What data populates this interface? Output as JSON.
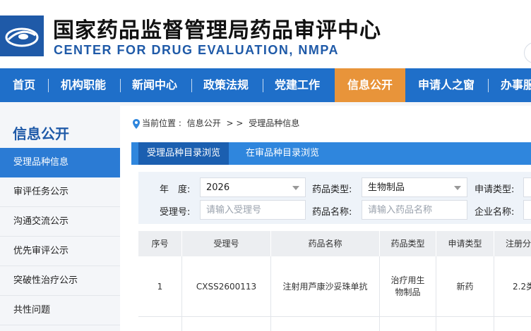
{
  "header": {
    "title": "国家药品监督管理局药品审评中心",
    "subtitle": "CENTER FOR DRUG EVALUATION, NMPA"
  },
  "nav": {
    "items": [
      {
        "label": "首页"
      },
      {
        "label": "机构职能"
      },
      {
        "label": "新闻中心"
      },
      {
        "label": "政策法规"
      },
      {
        "label": "党建工作"
      },
      {
        "label": "信息公开",
        "active": true
      },
      {
        "label": "申请人之窗"
      },
      {
        "label": "办事服"
      }
    ]
  },
  "sidebar": {
    "title": "信息公开",
    "items": [
      {
        "label": "受理品种信息",
        "active": true
      },
      {
        "label": "审评任务公示"
      },
      {
        "label": "沟通交流公示"
      },
      {
        "label": "优先审评公示"
      },
      {
        "label": "突破性治疗公示"
      },
      {
        "label": "共性问题"
      }
    ]
  },
  "breadcrumb": {
    "prefix": "当前位置 :",
    "section": "信息公开",
    "separator": "> >",
    "current": "受理品种信息"
  },
  "tabs": [
    {
      "label": "受理品种目录浏览",
      "active": true
    },
    {
      "label": "在审品种目录浏览"
    }
  ],
  "filters": {
    "year_label": "年　度:",
    "year_value": "2026",
    "drug_type_label": "药品类型:",
    "drug_type_value": "生物制品",
    "apply_type_label": "申请类型:",
    "accept_no_label": "受理号:",
    "accept_no_placeholder": "请输入受理号",
    "drug_name_label": "药品名称:",
    "drug_name_placeholder": "请输入药品名称",
    "company_label": "企业名称:"
  },
  "table": {
    "headers": [
      "序号",
      "受理号",
      "药品名称",
      "药品类型",
      "申请类型",
      "注册分"
    ],
    "rows": [
      {
        "no": "1",
        "accept_no": "CXSS2600113",
        "drug_name": "注射用芦康沙妥珠单抗",
        "drug_type_line1": "治疗用生",
        "drug_type_line2": "物制品",
        "apply_type": "新药",
        "reg_class": "2.2类"
      }
    ]
  },
  "colors": {
    "nav_bg": "#1f6fc9",
    "nav_active": "#e8943a",
    "brand_blue": "#1f5aa8",
    "tab_active": "#1b5fb0",
    "sidebar_active": "#2b7bd4"
  }
}
